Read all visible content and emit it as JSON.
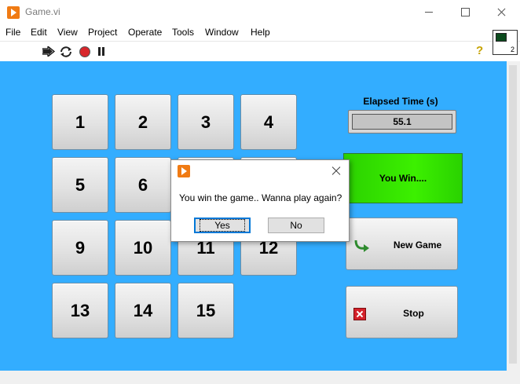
{
  "window": {
    "title": "Game.vi"
  },
  "menu": [
    "File",
    "Edit",
    "View",
    "Project",
    "Operate",
    "Tools",
    "Window",
    "Help"
  ],
  "vi_icon": {
    "number": "2"
  },
  "tiles": [
    "1",
    "2",
    "3",
    "4",
    "5",
    "6",
    "",
    "",
    "9",
    "10",
    "11",
    "12",
    "13",
    "14",
    "15"
  ],
  "elapsed": {
    "label": "Elapsed Time (s)",
    "value": "55.1"
  },
  "status": {
    "label": "You Win....",
    "color": "#33e600"
  },
  "buttons": {
    "new_game": "New Game",
    "stop": "Stop"
  },
  "dialog": {
    "message": "You win the game.. Wanna play again?",
    "yes": "Yes",
    "no": "No"
  },
  "colors": {
    "panel": "#33adff",
    "accent": "#f07b14"
  }
}
